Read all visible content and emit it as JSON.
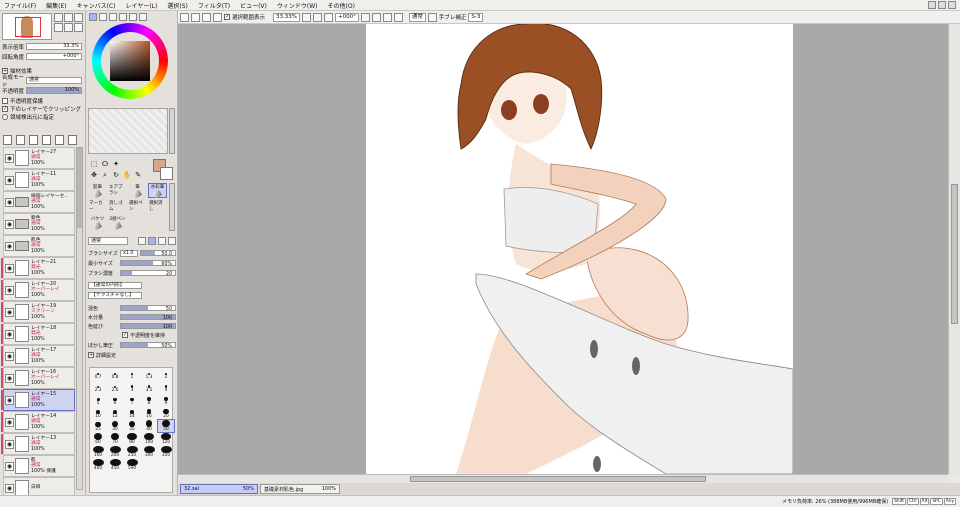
{
  "menu": [
    "ファイル(F)",
    "編集(E)",
    "キャンバス(C)",
    "レイヤー(L)",
    "選択(S)",
    "フィルタ(T)",
    "ビュー(V)",
    "ウィンドウ(W)",
    "その他(O)"
  ],
  "navigator": {
    "zoom_label": "表示倍率",
    "zoom_value": "33.3%",
    "rot_label": "回転角度",
    "rot_value": "+000°"
  },
  "layer_effect": {
    "title": "描材効果",
    "blend_label": "合成モード",
    "blend_value": "通常",
    "opacity_label": "不透明度",
    "opacity_value": "100%",
    "protect": "不透明度保護",
    "clip": "下のレイヤーでクリッピング",
    "select_src": "領域検出元に指定"
  },
  "layers": [
    {
      "name": "レイヤー27",
      "mode": "通常",
      "op": "100%",
      "type": "layer"
    },
    {
      "name": "レイヤー11",
      "mode": "通常",
      "op": "100%",
      "type": "layer"
    },
    {
      "name": "線画レイヤーセ..",
      "mode": "通常",
      "op": "100%",
      "type": "folder"
    },
    {
      "name": "髪色",
      "mode": "通常",
      "op": "100%",
      "type": "folder"
    },
    {
      "name": "肌色",
      "mode": "通常",
      "op": "100%",
      "type": "folder"
    },
    {
      "name": "レイヤー21",
      "mode": "発光",
      "op": "100%",
      "type": "layer",
      "clip": true
    },
    {
      "name": "レイヤー20",
      "mode": "オーバーレイ",
      "op": "100%",
      "type": "layer",
      "clip": true
    },
    {
      "name": "レイヤー19",
      "mode": "スクリーン",
      "op": "100%",
      "type": "layer",
      "clip": true
    },
    {
      "name": "レイヤー18",
      "mode": "発光",
      "op": "100%",
      "type": "layer",
      "clip": true
    },
    {
      "name": "レイヤー17",
      "mode": "通常",
      "op": "100%",
      "type": "layer",
      "clip": true
    },
    {
      "name": "レイヤー16",
      "mode": "オーバーレイ",
      "op": "100%",
      "type": "layer",
      "clip": true
    },
    {
      "name": "レイヤー15",
      "mode": "通常",
      "op": "100%",
      "type": "layer",
      "clip": true,
      "selected": true
    },
    {
      "name": "レイヤー14",
      "mode": "通常",
      "op": "100%",
      "type": "layer",
      "clip": true
    },
    {
      "name": "レイヤー13",
      "mode": "通常",
      "op": "100%",
      "type": "layer",
      "clip": true
    },
    {
      "name": "肌",
      "mode": "通常",
      "op": "100% 保護",
      "type": "layer"
    },
    {
      "name": "白目",
      "mode": "",
      "op": "",
      "type": "layer"
    }
  ],
  "brushes": [
    "鉛筆",
    "エアブラシ",
    "筆",
    "水彩筆",
    "マーカー",
    "消しゴム",
    "選択ペン",
    "選択消し",
    "バケツ",
    "2値ペン",
    "",
    ""
  ],
  "brush_settings": {
    "blend": "通常",
    "size_label": "ブラシサイズ",
    "size_mult": "x1.0",
    "size_value": "50.0",
    "min_label": "最小サイズ",
    "min_value": "60%",
    "density_label": "ブラシ濃度",
    "density_value": "20",
    "shape": "【通常の円形】",
    "texture": "【テクスチャなし】",
    "blend2_label": "混色",
    "blend2_value": "50",
    "water_label": "水分量",
    "water_value": "100",
    "stretch_label": "色延び",
    "stretch_value": "100",
    "keep_op": "不透明度を維持",
    "blur_label": "ぼかし筆圧",
    "blur_value": "50%",
    "detail": "詳細設定"
  },
  "sizes": [
    "0.7",
    "0.8",
    "1",
    "1.3",
    "2",
    "2.3",
    "2.6",
    "3",
    "3.5",
    "4",
    "5",
    "6",
    "7",
    "8",
    "9",
    "10",
    "12",
    "14",
    "16",
    "20",
    "25",
    "30",
    "35",
    "40",
    "50",
    "60",
    "70",
    "80",
    "100",
    "120",
    "160",
    "200",
    "250",
    "300",
    "350",
    "400",
    "450",
    "500"
  ],
  "topbar": {
    "select_show": "選択範囲表示",
    "zoom": "33.33%",
    "rot": "+000°",
    "blend": "通常",
    "stabilizer_label": "手ブレ補正",
    "stabilizer": "S-3"
  },
  "docs": [
    {
      "name": "32.sai",
      "pct": "50%",
      "selected": true
    },
    {
      "name": "基礎素材肌色.jpg",
      "pct": "100%",
      "selected": false
    }
  ],
  "status": {
    "memory": "メモリ負荷率: 26% (388MB使用/996MB確保)",
    "keys": [
      "Shift",
      "Ctrl",
      "Alt",
      "SPC",
      "Any"
    ]
  }
}
